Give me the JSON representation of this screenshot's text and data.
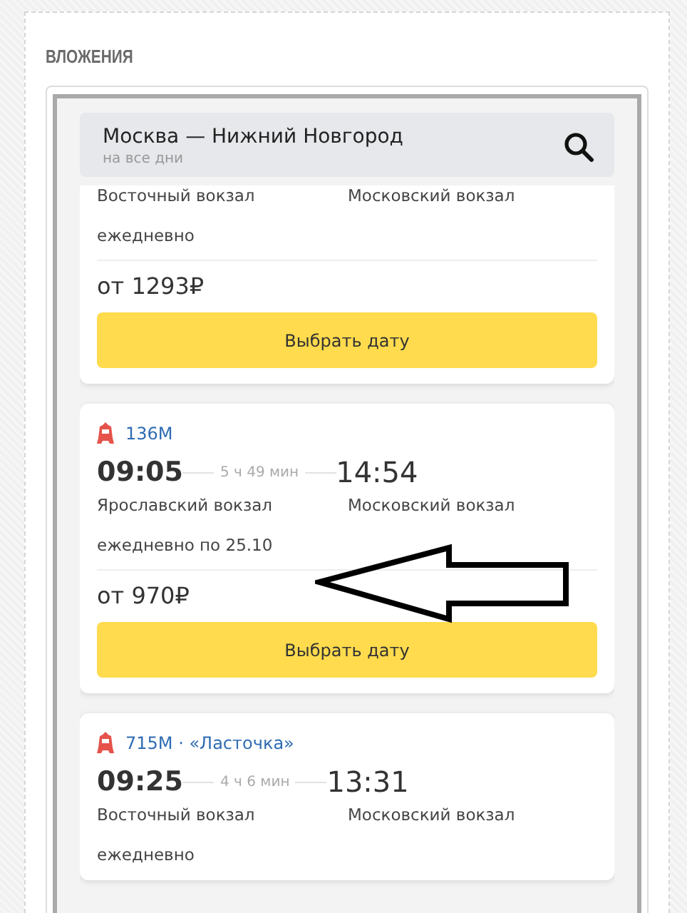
{
  "section_title": "ВЛОЖЕНИЯ",
  "search": {
    "route": "Москва — Нижний Новгород",
    "subtitle": "на все дни"
  },
  "trips": [
    {
      "station_from": "Восточный вокзал",
      "station_to": "Московский вокзал",
      "schedule": "ежедневно",
      "price": "от 1293₽",
      "button": "Выбрать дату"
    },
    {
      "train": "136М",
      "departure": "09:05",
      "duration": "5 ч 49 мин",
      "arrival": "14:54",
      "station_from": "Ярославский вокзал",
      "station_to": "Московский вокзал",
      "schedule": "ежедневно по 25.10",
      "price": "от 970₽",
      "button": "Выбрать дату"
    },
    {
      "train": "715М · «Ласточка»",
      "departure": "09:25",
      "duration": "4 ч 6 мин",
      "arrival": "13:31",
      "station_from": "Восточный вокзал",
      "station_to": "Московский вокзал",
      "schedule": "ежедневно"
    }
  ]
}
